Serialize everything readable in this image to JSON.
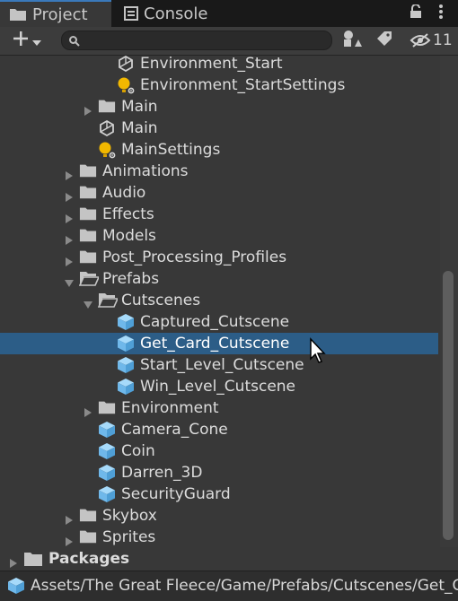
{
  "tabs": [
    {
      "label": "Project",
      "icon": "folder-icon",
      "active": true
    },
    {
      "label": "Console",
      "icon": "console-icon",
      "active": false
    }
  ],
  "toolbar": {
    "create_icon": "plus-icon",
    "search_value": "",
    "hidden_count": "11"
  },
  "tree": [
    {
      "label": "Environment_Start",
      "icon": "unity-scene-icon",
      "depth": 5,
      "arrow": "none"
    },
    {
      "label": "Environment_StartSettings",
      "icon": "lighting-settings-icon",
      "depth": 5,
      "arrow": "none"
    },
    {
      "label": "Main",
      "icon": "folder-icon",
      "depth": 4,
      "arrow": "collapsed"
    },
    {
      "label": "Main",
      "icon": "unity-scene-icon",
      "depth": 4,
      "arrow": "none"
    },
    {
      "label": "MainSettings",
      "icon": "lighting-settings-icon",
      "depth": 4,
      "arrow": "none"
    },
    {
      "label": "Animations",
      "icon": "folder-icon",
      "depth": 3,
      "arrow": "collapsed"
    },
    {
      "label": "Audio",
      "icon": "folder-icon",
      "depth": 3,
      "arrow": "collapsed"
    },
    {
      "label": "Effects",
      "icon": "folder-icon",
      "depth": 3,
      "arrow": "collapsed"
    },
    {
      "label": "Models",
      "icon": "folder-icon",
      "depth": 3,
      "arrow": "collapsed"
    },
    {
      "label": "Post_Processing_Profiles",
      "icon": "folder-icon",
      "depth": 3,
      "arrow": "collapsed"
    },
    {
      "label": "Prefabs",
      "icon": "folder-open-icon",
      "depth": 3,
      "arrow": "expanded"
    },
    {
      "label": "Cutscenes",
      "icon": "folder-open-icon",
      "depth": 4,
      "arrow": "expanded"
    },
    {
      "label": "Captured_Cutscene",
      "icon": "prefab-icon",
      "depth": 5,
      "arrow": "none"
    },
    {
      "label": "Get_Card_Cutscene",
      "icon": "prefab-icon",
      "depth": 5,
      "arrow": "none",
      "selected": true
    },
    {
      "label": "Start_Level_Cutscene",
      "icon": "prefab-icon",
      "depth": 5,
      "arrow": "none"
    },
    {
      "label": "Win_Level_Cutscene",
      "icon": "prefab-icon",
      "depth": 5,
      "arrow": "none"
    },
    {
      "label": "Environment",
      "icon": "folder-icon",
      "depth": 4,
      "arrow": "collapsed"
    },
    {
      "label": "Camera_Cone",
      "icon": "prefab-icon",
      "depth": 4,
      "arrow": "none"
    },
    {
      "label": "Coin",
      "icon": "prefab-icon",
      "depth": 4,
      "arrow": "none"
    },
    {
      "label": "Darren_3D",
      "icon": "prefab-icon",
      "depth": 4,
      "arrow": "none"
    },
    {
      "label": "SecurityGuard",
      "icon": "prefab-icon",
      "depth": 4,
      "arrow": "none"
    },
    {
      "label": "Skybox",
      "icon": "folder-icon",
      "depth": 3,
      "arrow": "collapsed"
    },
    {
      "label": "Sprites",
      "icon": "folder-icon",
      "depth": 3,
      "arrow": "collapsed"
    }
  ],
  "packages": {
    "label": "Packages",
    "icon": "folder-icon"
  },
  "path": {
    "icon": "prefab-icon",
    "text": "Assets/The Great Fleece/Game/Prefabs/Cutscenes/Get_Card_Cutscene.prefab"
  },
  "colors": {
    "background": "#383838",
    "selection": "#2c5d87",
    "prefab": "#7fc3f0",
    "folder": "#c4c4c4",
    "settings": "#f2b800",
    "tab_accent": "#3a79bb"
  }
}
